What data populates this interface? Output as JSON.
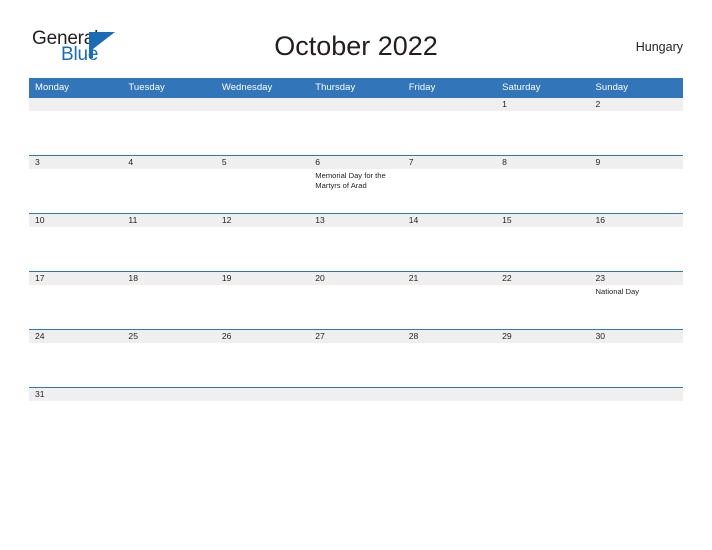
{
  "brand": {
    "name_part1": "General",
    "name_part2": "Blue",
    "accent_color": "#1b6cb5",
    "triangle_icon": "triangle-logo-icon"
  },
  "header": {
    "title": "October 2022",
    "country": "Hungary"
  },
  "calendar": {
    "header_color": "#3275b8",
    "daynum_band_color": "#efefef",
    "weekday_headers": [
      "Monday",
      "Tuesday",
      "Wednesday",
      "Thursday",
      "Friday",
      "Saturday",
      "Sunday"
    ],
    "weeks": [
      [
        {
          "day": ""
        },
        {
          "day": ""
        },
        {
          "day": ""
        },
        {
          "day": ""
        },
        {
          "day": ""
        },
        {
          "day": "1"
        },
        {
          "day": "2"
        }
      ],
      [
        {
          "day": "3"
        },
        {
          "day": "4"
        },
        {
          "day": "5"
        },
        {
          "day": "6",
          "event": "Memorial Day for the Martyrs of Arad"
        },
        {
          "day": "7"
        },
        {
          "day": "8"
        },
        {
          "day": "9"
        }
      ],
      [
        {
          "day": "10"
        },
        {
          "day": "11"
        },
        {
          "day": "12"
        },
        {
          "day": "13"
        },
        {
          "day": "14"
        },
        {
          "day": "15"
        },
        {
          "day": "16"
        }
      ],
      [
        {
          "day": "17"
        },
        {
          "day": "18"
        },
        {
          "day": "19"
        },
        {
          "day": "20"
        },
        {
          "day": "21"
        },
        {
          "day": "22"
        },
        {
          "day": "23",
          "event": "National Day"
        }
      ],
      [
        {
          "day": "24"
        },
        {
          "day": "25"
        },
        {
          "day": "26"
        },
        {
          "day": "27"
        },
        {
          "day": "28"
        },
        {
          "day": "29"
        },
        {
          "day": "30"
        }
      ],
      [
        {
          "day": "31"
        },
        {
          "day": ""
        },
        {
          "day": ""
        },
        {
          "day": ""
        },
        {
          "day": ""
        },
        {
          "day": ""
        },
        {
          "day": ""
        }
      ]
    ]
  }
}
